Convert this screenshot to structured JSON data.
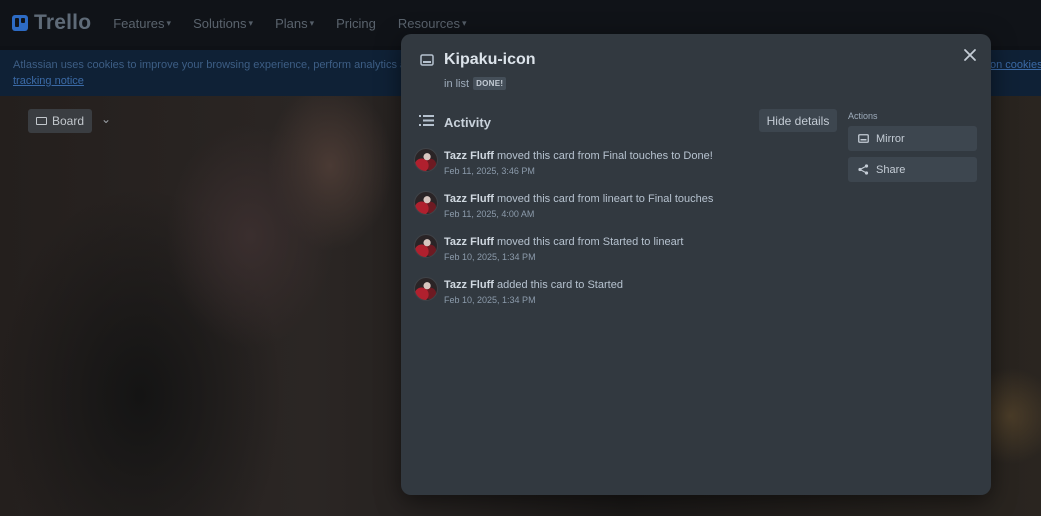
{
  "nav": {
    "logo": "Trello",
    "links": [
      {
        "label": "Features",
        "has_chevron": true
      },
      {
        "label": "Solutions",
        "has_chevron": true
      },
      {
        "label": "Plans",
        "has_chevron": true
      },
      {
        "label": "Pricing",
        "has_chevron": false
      },
      {
        "label": "Resources",
        "has_chevron": true
      }
    ]
  },
  "cookie": {
    "text": "Atlassian uses cookies to improve your browsing experience, perform analytics and",
    "link": "tracking notice",
    "right_link": "on cookies"
  },
  "board": {
    "view_label": "Board"
  },
  "modal": {
    "title": "Kipaku-icon",
    "in_list_prefix": "in list",
    "list_name": "DONE!",
    "activity_title": "Activity",
    "hide_details_label": "Hide details",
    "actions_label": "Actions",
    "actions": [
      {
        "label": "Mirror",
        "icon": "card-icon"
      },
      {
        "label": "Share",
        "icon": "share-icon"
      }
    ],
    "entries": [
      {
        "user": "Tazz Fluff",
        "text": "moved this card from Final touches to Done!",
        "time": "Feb 11, 2025, 3:46 PM"
      },
      {
        "user": "Tazz Fluff",
        "text": "moved this card from lineart to Final touches",
        "time": "Feb 11, 2025, 4:00 AM"
      },
      {
        "user": "Tazz Fluff",
        "text": "moved this card from Started to lineart",
        "time": "Feb 10, 2025, 1:34 PM"
      },
      {
        "user": "Tazz Fluff",
        "text": "added this card to Started",
        "time": "Feb 10, 2025, 1:34 PM"
      }
    ]
  },
  "colors": {
    "modal_bg": "#323940",
    "button_bg": "#3d464f",
    "text": "#b6c2cf",
    "accent": "#2d6bc4"
  }
}
